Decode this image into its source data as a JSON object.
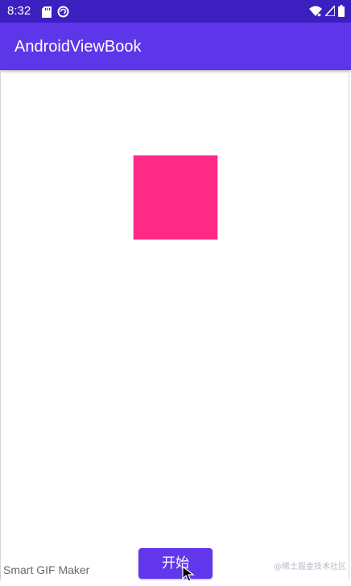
{
  "status_bar": {
    "time": "8:32",
    "left_icons": [
      "sd-card-icon",
      "sync-circle-icon"
    ],
    "right_icons": [
      "wifi-icon",
      "signal-icon",
      "battery-icon"
    ],
    "background": "#3c1fbf"
  },
  "app_bar": {
    "title": "AndroidViewBook",
    "background": "#5c36e8"
  },
  "content": {
    "square_color": "#ff2a85",
    "start_button_label": "开始",
    "button_color": "#6237ec"
  },
  "watermarks": {
    "left": "Smart GIF Maker",
    "right": "@稀土掘金技术社区"
  }
}
